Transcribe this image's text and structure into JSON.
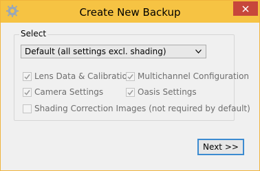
{
  "window": {
    "title": "Create New Backup",
    "accent": "#f6c343",
    "close_color": "#c7473b"
  },
  "group": {
    "label": "Select"
  },
  "select": {
    "value": "Default (all settings excl. shading)"
  },
  "options": [
    {
      "label": "Lens Data & Calibration",
      "checked": true,
      "enabled": false
    },
    {
      "label": "Multichannel Configuration",
      "checked": true,
      "enabled": false
    },
    {
      "label": "Camera Settings",
      "checked": true,
      "enabled": false
    },
    {
      "label": "Oasis Settings",
      "checked": true,
      "enabled": false
    },
    {
      "label": "Shading Correction Images (not required by default)",
      "checked": false,
      "enabled": false
    }
  ],
  "buttons": {
    "next_label": "Next >>"
  }
}
